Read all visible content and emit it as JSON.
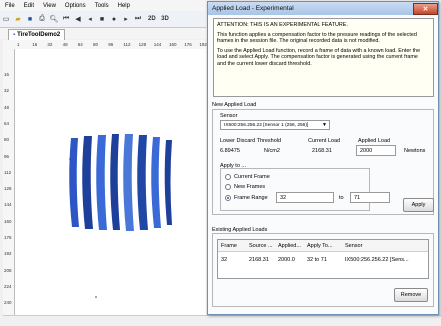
{
  "menu": [
    "File",
    "Edit",
    "View",
    "Options",
    "Tools",
    "Help"
  ],
  "toolbar": {
    "icons": [
      "new-file-icon",
      "open-folder-icon",
      "save-icon",
      "print-icon",
      "print-preview-icon",
      "first-frame-icon",
      "prev-frame-icon",
      "play-back-icon",
      "stop-icon",
      "record-icon",
      "play-icon",
      "last-frame-icon"
    ],
    "view2d": "2D",
    "view3d": "3D"
  },
  "document": {
    "tab_title": "TireToolDemo2",
    "ruler_h": [
      "1",
      "16",
      "32",
      "48",
      "64",
      "80",
      "96",
      "112",
      "128",
      "144",
      "160",
      "176",
      "192"
    ],
    "ruler_v": [
      "16",
      "32",
      "48",
      "64",
      "80",
      "96",
      "112",
      "128",
      "144",
      "160",
      "176",
      "192",
      "208",
      "224",
      "240",
      "256"
    ]
  },
  "dialog": {
    "title": "Applied Load - Experimental",
    "close": "✕",
    "info_lines": [
      "ATTENTION: THIS IS AN EXPERIMENTAL FEATURE.",
      "This function applies a compensation factor to the pressure readings of the selected",
      "frames in the session file.  The original recorded data is not modified.",
      "To use the Applied Load function, record a frame of data with a known load.  Enter the",
      "load and select Apply.  The compensation factor is generated using the current frame",
      "and the current lower discard threshold."
    ],
    "new_load": {
      "group_label": "New Applied Load",
      "sensor_label": "Sensor",
      "sensor_value": "IX500:256.256.22 [Sensor 1 (256, 256)]",
      "threshold_label": "Lower Discard Threshold",
      "threshold_value": "6.89475",
      "threshold_unit": "N/cm2",
      "current_label": "Current Load",
      "current_value": "2168.31",
      "applied_label": "Applied Load",
      "applied_value": "2000",
      "applied_unit": "Newtons",
      "apply_to_label": "Apply to ...",
      "options": [
        "Current Frame",
        "New Frames",
        "Frame Range"
      ],
      "selected_option": 2,
      "range_from": "32",
      "range_to_label": "to",
      "range_to": "71",
      "apply_button": "Apply"
    },
    "existing": {
      "group_label": "Existing Applied Loads",
      "columns": [
        "Frame",
        "Source ...",
        "Applied...",
        "Apply To...",
        "Sensor"
      ],
      "rows": [
        [
          "32",
          "2168.31",
          "2000.0",
          "32 to 71",
          "IX500:256.256.22 [Sens..."
        ]
      ],
      "remove_button": "Remove"
    }
  },
  "colors": {
    "title_bar": "#b8cfee",
    "pressure_dark": "#1e3f9a",
    "pressure_light": "#4a78d8"
  }
}
